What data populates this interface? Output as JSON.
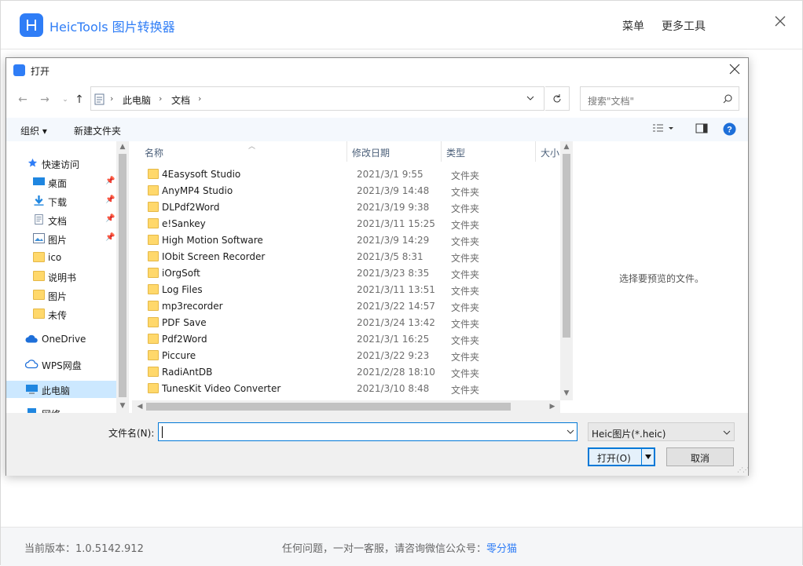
{
  "app": {
    "title": "HeicTools 图片转换器",
    "menu_label": "菜单",
    "more_tools_label": "更多工具",
    "version_text": "当前版本：1.0.5142.912",
    "contact_text": "任何问题，一对一客服，请咨询微信公众号：",
    "contact_link": "零分猫",
    "accent_color": "#2f7df6"
  },
  "dialog": {
    "title": "打开",
    "address": [
      "此电脑",
      "文档"
    ],
    "search_placeholder": "搜索\"文档\"",
    "toolbar": {
      "organize": "组织",
      "new_folder": "新建文件夹"
    },
    "nav_items": [
      {
        "label": "快速访问",
        "icon": "star-icon"
      },
      {
        "label": "桌面",
        "icon": "desktop-icon",
        "pinned": true
      },
      {
        "label": "下载",
        "icon": "download-icon",
        "pinned": true
      },
      {
        "label": "文档",
        "icon": "document-icon",
        "pinned": true
      },
      {
        "label": "图片",
        "icon": "picture-icon",
        "pinned": true
      },
      {
        "label": "ico",
        "icon": "folder-icon"
      },
      {
        "label": "说明书",
        "icon": "folder-icon"
      },
      {
        "label": "图片",
        "icon": "folder-icon"
      },
      {
        "label": "未传",
        "icon": "folder-icon"
      },
      {
        "label": "OneDrive",
        "icon": "cloud-icon"
      },
      {
        "label": "WPS网盘",
        "icon": "cloud-icon"
      },
      {
        "label": "此电脑",
        "icon": "computer-icon",
        "selected": true
      },
      {
        "label": "网络",
        "icon": "network-icon"
      }
    ],
    "columns": {
      "name": "名称",
      "date": "修改日期",
      "type": "类型",
      "size": "大小"
    },
    "files": [
      {
        "name": "4Easysoft Studio",
        "date": "2021/3/1 9:55",
        "type": "文件夹"
      },
      {
        "name": "AnyMP4 Studio",
        "date": "2021/3/9 14:48",
        "type": "文件夹"
      },
      {
        "name": "DLPdf2Word",
        "date": "2021/3/19 9:38",
        "type": "文件夹"
      },
      {
        "name": "e!Sankey",
        "date": "2021/3/11 15:25",
        "type": "文件夹"
      },
      {
        "name": "High Motion Software",
        "date": "2021/3/9 14:29",
        "type": "文件夹"
      },
      {
        "name": "IObit Screen Recorder",
        "date": "2021/3/5 8:31",
        "type": "文件夹"
      },
      {
        "name": "iOrgSoft",
        "date": "2021/3/23 8:35",
        "type": "文件夹"
      },
      {
        "name": "Log Files",
        "date": "2021/3/11 13:51",
        "type": "文件夹"
      },
      {
        "name": "mp3recorder",
        "date": "2021/3/22 14:57",
        "type": "文件夹"
      },
      {
        "name": "PDF Save",
        "date": "2021/3/24 13:42",
        "type": "文件夹"
      },
      {
        "name": "Pdf2Word",
        "date": "2021/3/1 16:25",
        "type": "文件夹"
      },
      {
        "name": "Piccure",
        "date": "2021/3/22 9:23",
        "type": "文件夹"
      },
      {
        "name": "RadiAntDB",
        "date": "2021/2/28 18:10",
        "type": "文件夹"
      },
      {
        "name": "TunesKit Video Converter",
        "date": "2021/3/10 8:48",
        "type": "文件夹"
      }
    ],
    "preview_text": "选择要预览的文件。",
    "filename_label": "文件名(N):",
    "filename_value": "",
    "filetype_value": "Heic图片(*.heic)",
    "open_label": "打开(O)",
    "cancel_label": "取消"
  }
}
